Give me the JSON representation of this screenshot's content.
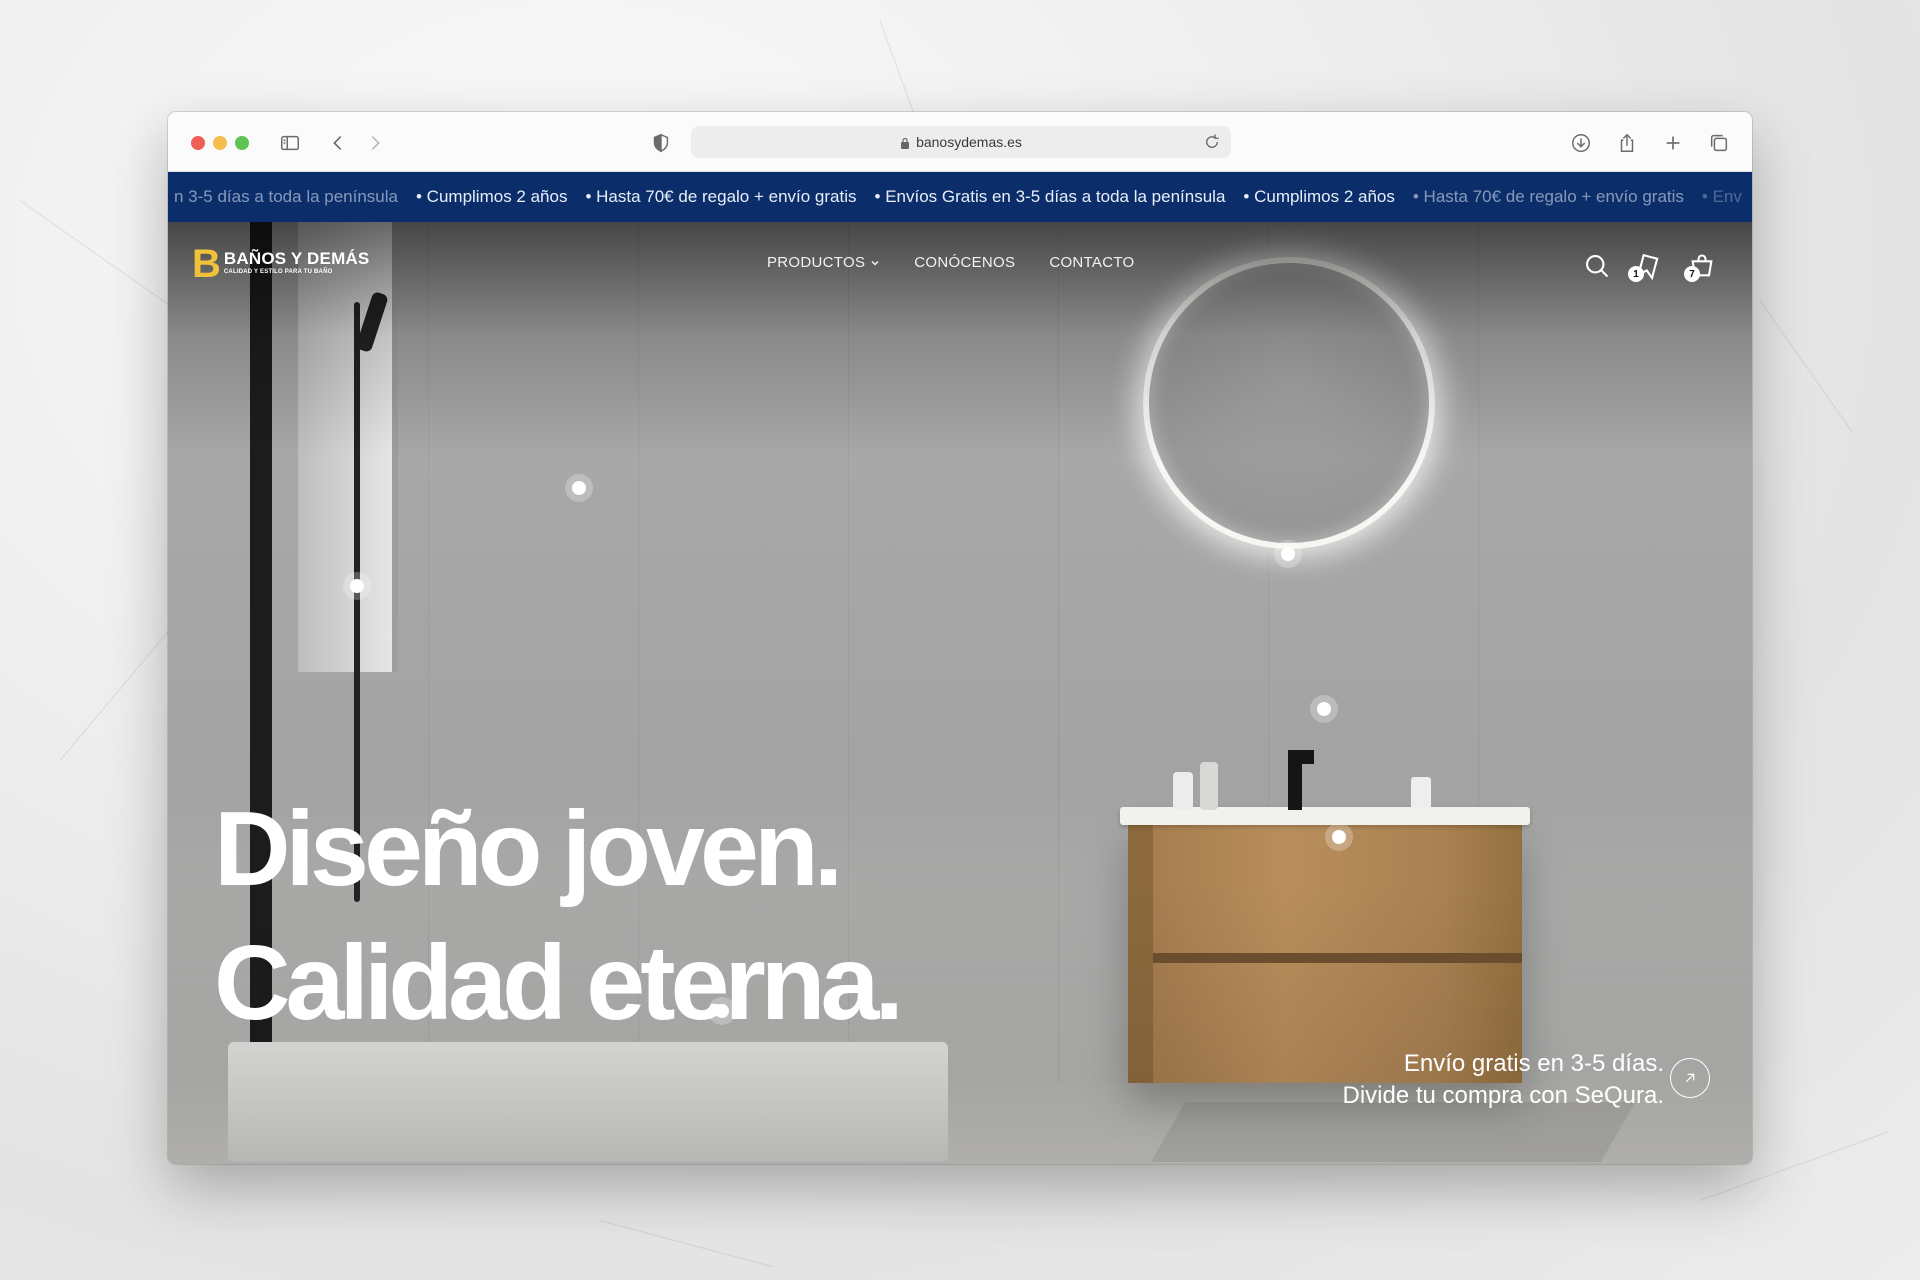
{
  "browser": {
    "url": "banosydemas.es",
    "icons": [
      "sidebar-icon",
      "back-icon",
      "forward-icon",
      "shield-icon",
      "lock-icon",
      "reload-icon",
      "download-icon",
      "share-icon",
      "new-tab-icon",
      "tabs-overview-icon"
    ]
  },
  "announcement_bar": {
    "items": [
      "n 3-5 días a toda la península",
      "• Cumplimos 2 años",
      "• Hasta 70€ de regalo + envío gratis",
      "• Envíos Gratis en 3-5 días a toda la península",
      "• Cumplimos 2 años",
      "• Hasta 70€ de regalo + envío gratis",
      "• Env"
    ],
    "background": "#0b2e6a"
  },
  "brand": {
    "logo_letter": "B",
    "name": "BAÑOS Y DEMÁS",
    "tagline": "CALIDAD Y ESTILO PARA TU BAÑO",
    "accent": "#f0c23a"
  },
  "nav": {
    "links": [
      "PRODUCTOS",
      "CONÓCENOS",
      "CONTACTO"
    ],
    "icons": [
      "search-icon",
      "wishlist-icon",
      "cart-icon"
    ],
    "wishlist_count": "1",
    "cart_count": "7"
  },
  "hero": {
    "headline_line1": "Diseño joven.",
    "headline_line2": "Calidad eterna.",
    "promo_line1": "Envío gratis en 3-5 días.",
    "promo_line2": "Divide tu compra con SeQura."
  }
}
